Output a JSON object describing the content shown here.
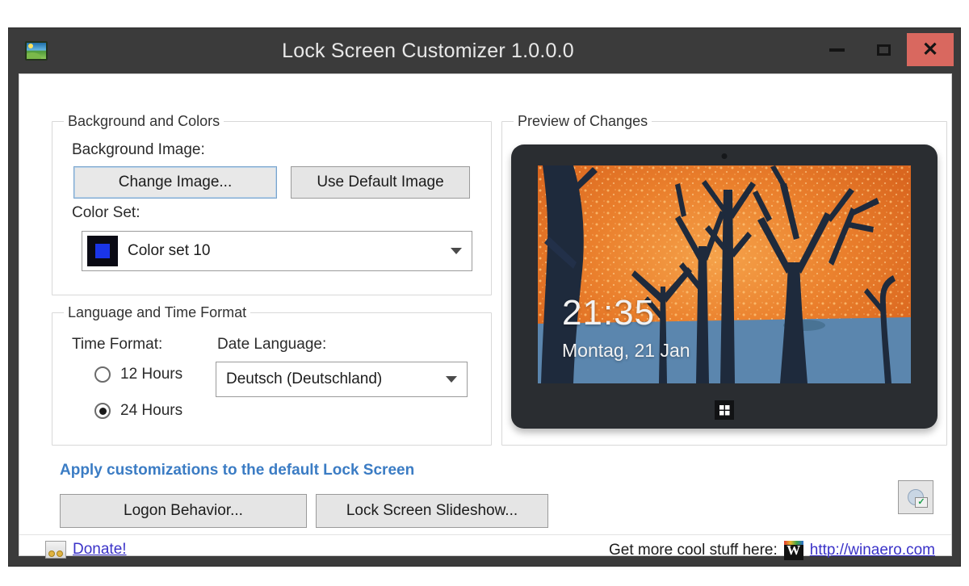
{
  "window": {
    "title": "Lock Screen Customizer 1.0.0.0",
    "app_icon": "picture-icon",
    "controls": {
      "minimize": "minimize-icon",
      "maximize": "maximize-icon",
      "close": "close-icon",
      "close_label": "✕"
    },
    "colors": {
      "titlebar": "#3b3b3b",
      "close_button": "#d9685f",
      "client": "#ffffff",
      "accent_link": "#3b7cc4",
      "hyperlink": "#3a32c8"
    }
  },
  "background_group": {
    "legend": "Background and Colors",
    "background_image_label": "Background Image:",
    "change_image_button": "Change Image...",
    "use_default_image_button": "Use Default Image",
    "color_set_label": "Color Set:",
    "color_set_value": "Color set 10",
    "color_set_swatch": "#1a35e8",
    "color_set_swatch_bg": "#0a0a14"
  },
  "language_group": {
    "legend": "Language and Time Format",
    "time_format_label": "Time Format:",
    "date_language_label": "Date Language:",
    "radio_12_hours": "12 Hours",
    "radio_24_hours": "24 Hours",
    "selected_time_format": "24 Hours",
    "date_language_value": "Deutsch (Deutschland)"
  },
  "preview_group": {
    "legend": "Preview of Changes",
    "lock_screen": {
      "time": "21:35",
      "date": "Montag, 21 Jan",
      "sky_color": "#e8792c",
      "ground_color": "#5b86ae",
      "tree_color": "#1e2a3c"
    },
    "windows_button": "windows-logo-icon",
    "camera": "camera-icon"
  },
  "actions": {
    "apply_link": "Apply customizations to the default Lock Screen",
    "logon_behavior_button": "Logon Behavior...",
    "lock_screen_slideshow_button": "Lock Screen Slideshow...",
    "extra_icon_button": "network-settings-icon"
  },
  "footer": {
    "donate_icon": "donate-icon",
    "donate_label": "Donate!",
    "promo_text": "Get more cool stuff here:",
    "brand_logo": "winaero-logo-icon",
    "brand_logo_letter": "W",
    "site_link": "http://winaero.com"
  }
}
